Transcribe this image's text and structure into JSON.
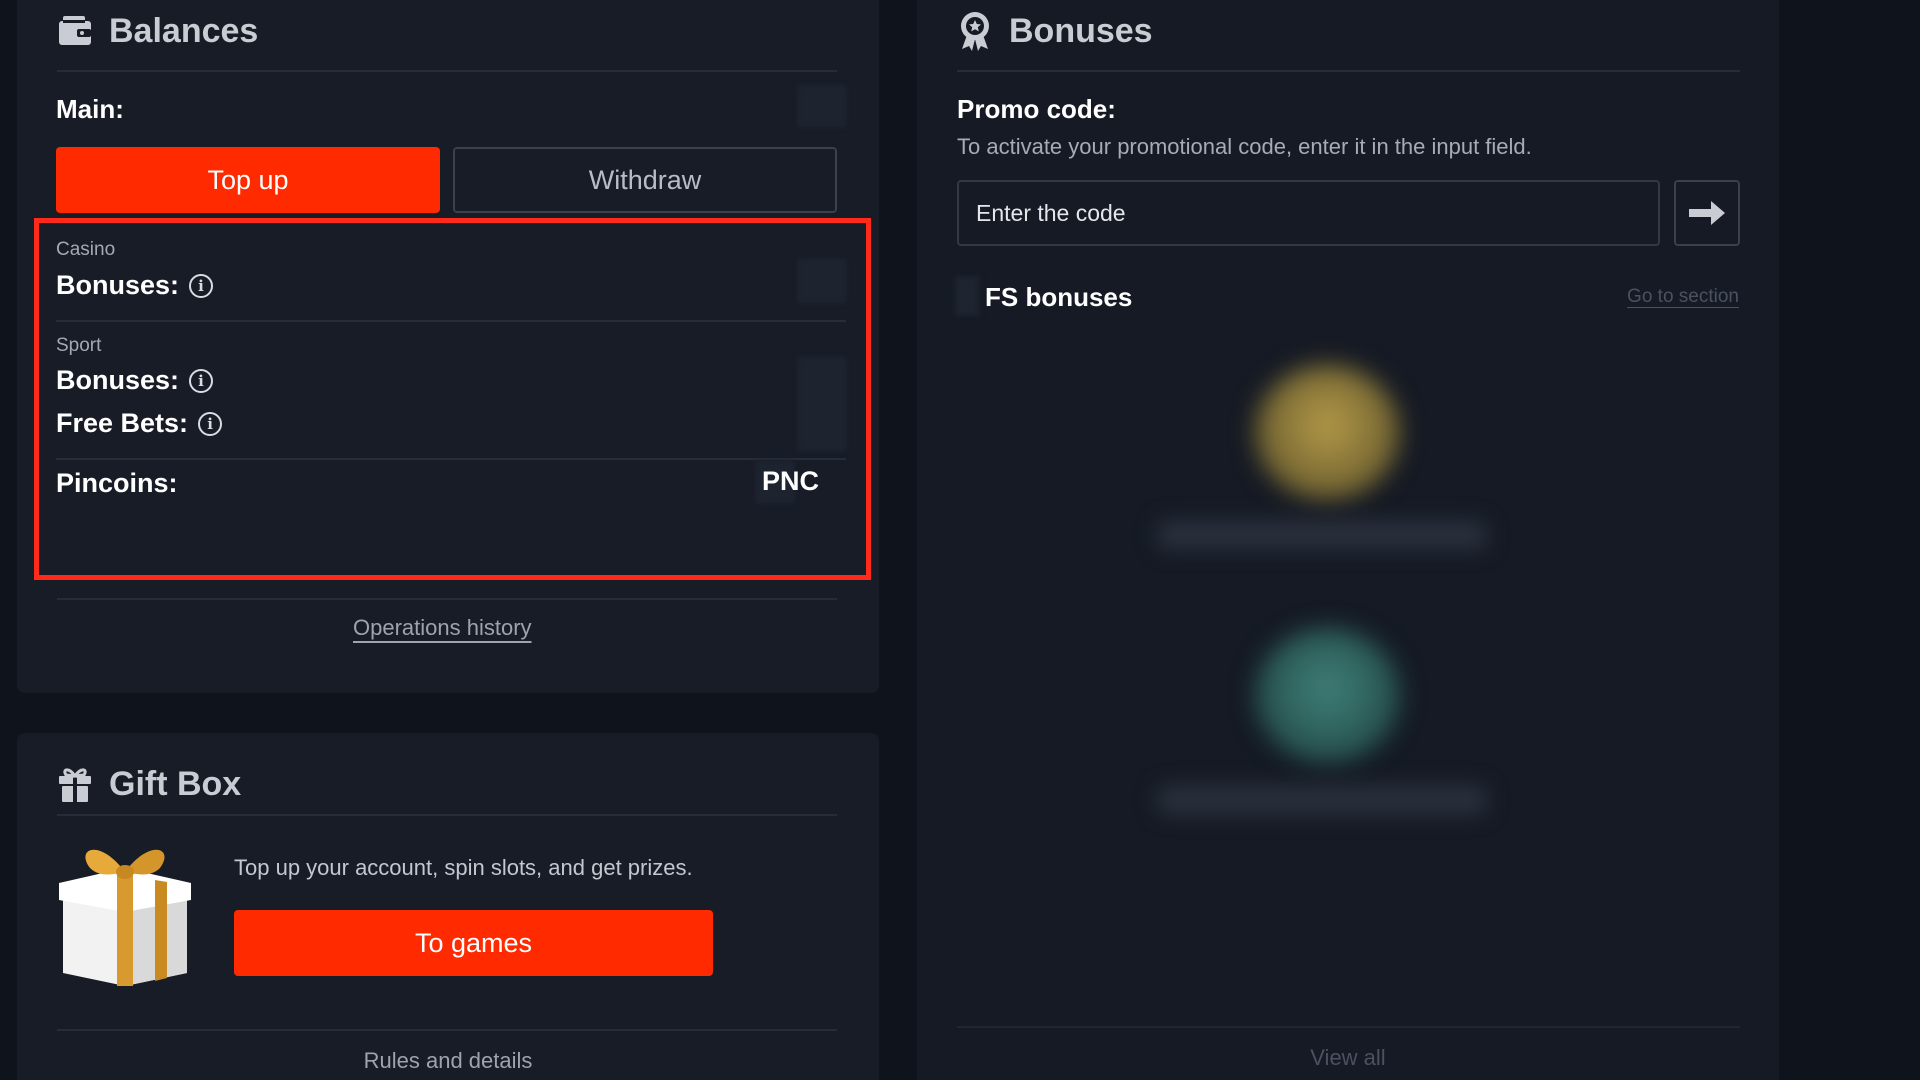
{
  "balances": {
    "title": "Balances",
    "main_label": "Main:",
    "topup_label": "Top up",
    "withdraw_label": "Withdraw",
    "casino": {
      "section": "Casino",
      "bonuses_label": "Bonuses:"
    },
    "sport": {
      "section": "Sport",
      "bonuses_label": "Bonuses:",
      "freebets_label": "Free Bets:"
    },
    "pincoins_label": "Pincoins:",
    "pincoins_currency": "PNC",
    "operations_history": "Operations history"
  },
  "gift_box": {
    "title": "Gift Box",
    "text": "Top up your account, spin slots, and get prizes.",
    "button_label": "To games",
    "rules_link": "Rules and details"
  },
  "bonuses": {
    "title": "Bonuses",
    "promo_title": "Promo code:",
    "promo_desc": "To activate your promotional code, enter it in the input field.",
    "code_placeholder": "Enter the code",
    "fs_title": "FS bonuses",
    "go_to_section": "Go to section",
    "view_all": "View all"
  },
  "colors": {
    "accent": "#ff2a00",
    "highlight_border": "#ff2a1a",
    "background": "#0f131c",
    "card": "#171c27"
  },
  "icons": {
    "balances": "wallet-icon",
    "gift": "gift-icon",
    "bonuses": "award-icon",
    "info": "info-icon",
    "submit": "arrow-right-icon"
  }
}
